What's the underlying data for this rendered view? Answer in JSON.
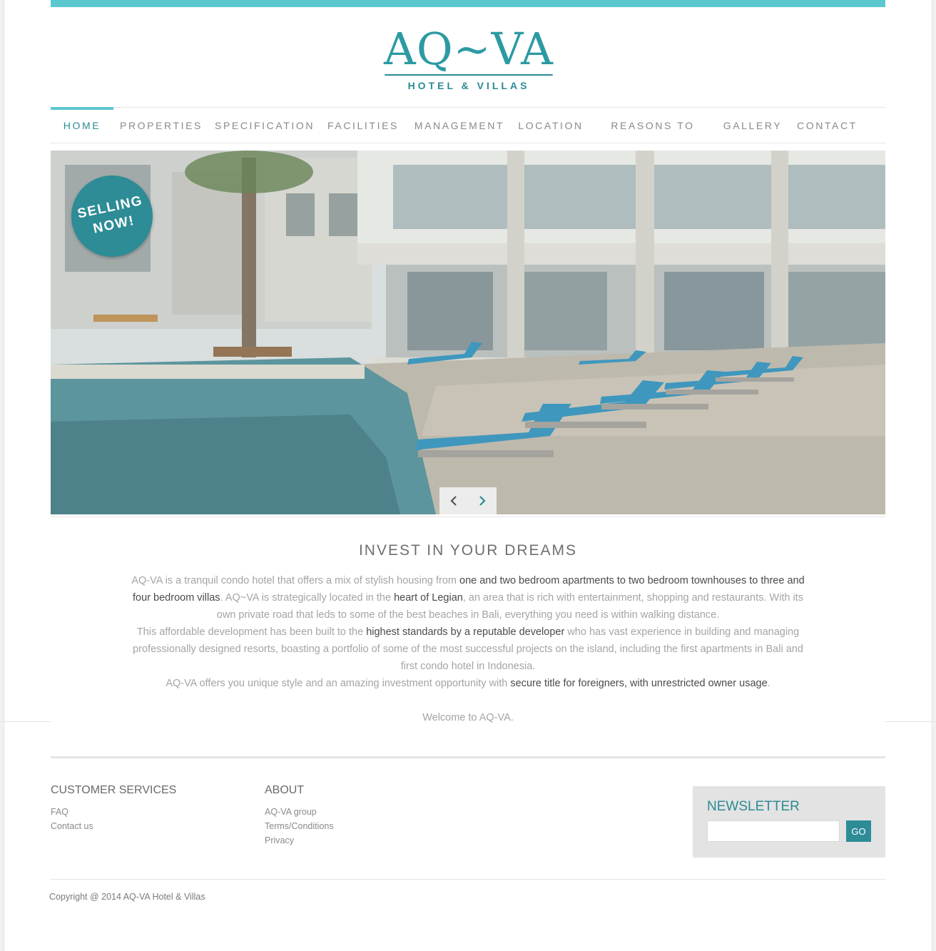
{
  "brand": {
    "logo_main": "AQ~VA",
    "logo_sub": "HOTEL & VILLAS",
    "accent": "#5bc7cf",
    "brand_dark": "#2d8c96"
  },
  "nav": {
    "items": [
      {
        "label": "HOME",
        "active": true
      },
      {
        "label": "PROPERTIES"
      },
      {
        "label": "SPECIFICATION"
      },
      {
        "label": "FACILITIES"
      },
      {
        "label": "MANAGEMENT"
      },
      {
        "label": "LOCATION"
      },
      {
        "label": "REASONS TO BUY"
      },
      {
        "label": "GALLERY"
      },
      {
        "label": "CONTACT"
      }
    ]
  },
  "hero": {
    "badge_line1": "SELLING",
    "badge_line2": "NOW!",
    "prev_icon": "chevron-left-icon",
    "next_icon": "chevron-right-icon"
  },
  "intro": {
    "title": "INVEST IN YOUR DREAMS",
    "p1_a": "AQ-VA is a tranquil condo hotel that offers a mix of stylish housing from ",
    "p1_b": "one and two bedroom apartments to two bedroom townhouses to three and four bedroom villas",
    "p1_c": ". AQ~VA is strategically located in the ",
    "p1_d": "heart of Legian",
    "p1_e": ", an area that is rich with entertainment, shopping and restaurants. With its own private road that leds to some of the best beaches in Bali, everything you need is within walking distance.",
    "p2_a": "This affordable development has been built to the ",
    "p2_b": "highest standards by a reputable developer",
    "p2_c": " who has vast experience in building and managing professionally designed resorts, boasting a portfolio of some of the most successful projects on the island, including the first apartments in Bali and first condo hotel in Indonesia.",
    "p3_a": "AQ-VA offers you unique style and an amazing investment opportunity with ",
    "p3_b": "secure title for foreigners, with unrestricted owner usage",
    "p3_c": ".",
    "welcome": "Welcome to AQ-VA."
  },
  "footer": {
    "customer_services": {
      "title": "CUSTOMER SERVICES",
      "links": [
        "FAQ",
        "Contact us"
      ]
    },
    "about": {
      "title": "ABOUT",
      "links": [
        "AQ-VA group",
        "Terms/Conditions",
        "Privacy"
      ]
    },
    "newsletter": {
      "title": "NEWSLETTER",
      "input_value": "",
      "button": "GO"
    },
    "copyright": "Copyright @ 2014 AQ-VA Hotel & Villas"
  }
}
